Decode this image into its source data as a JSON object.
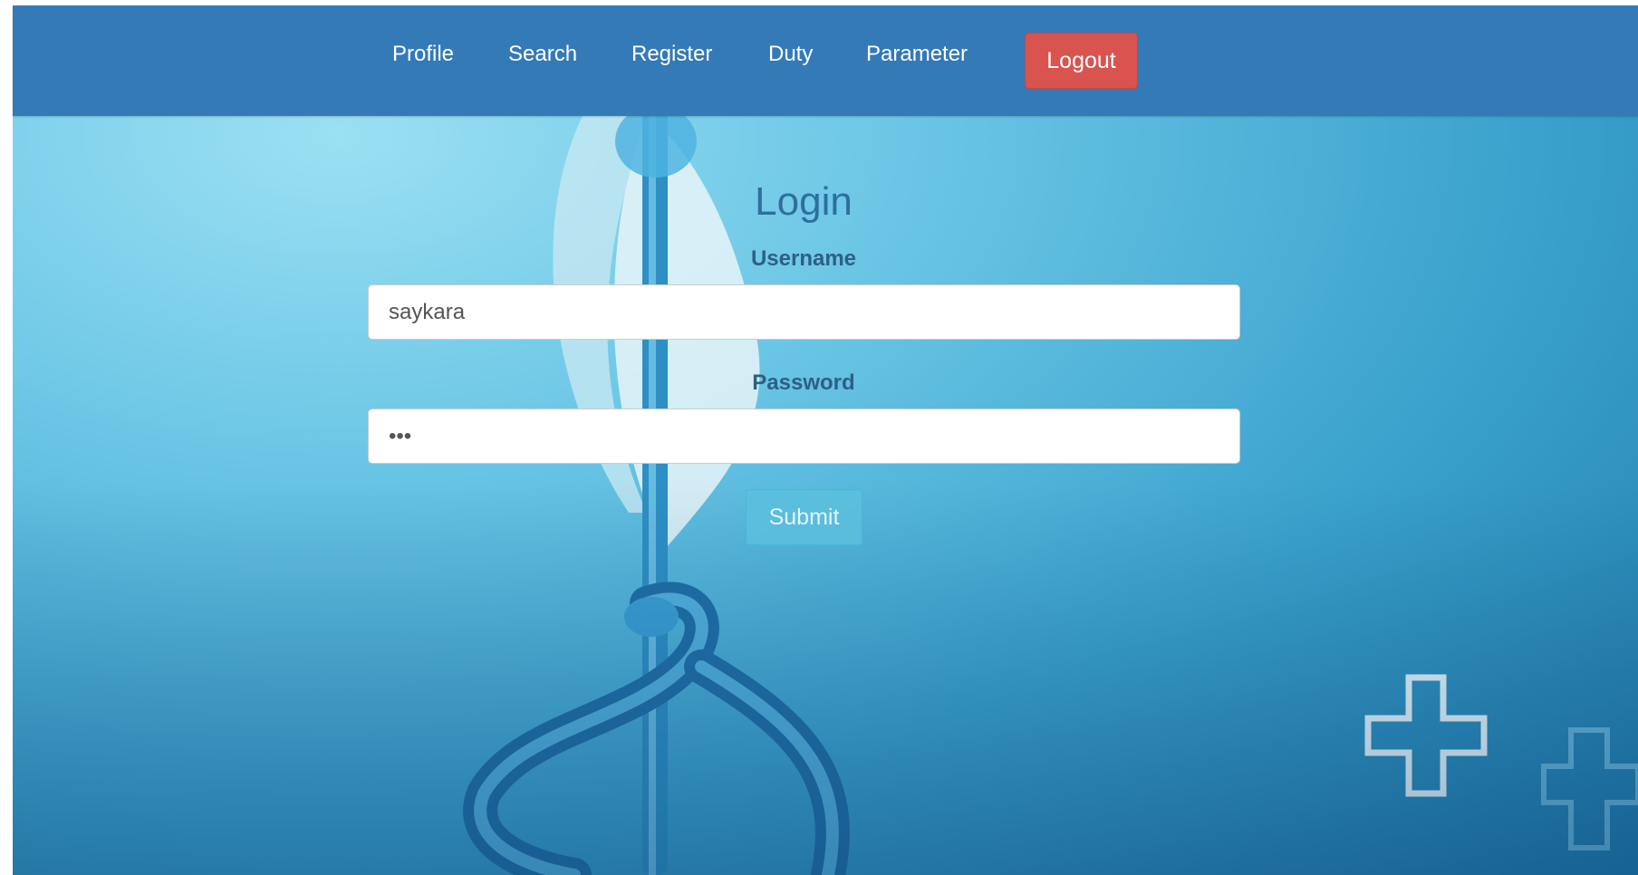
{
  "nav": {
    "items": [
      {
        "id": "profile",
        "label": "Profile"
      },
      {
        "id": "search",
        "label": "Search"
      },
      {
        "id": "register",
        "label": "Register"
      },
      {
        "id": "duty",
        "label": "Duty"
      },
      {
        "id": "parameter",
        "label": "Parameter"
      }
    ],
    "logout_label": "Logout"
  },
  "login": {
    "title": "Login",
    "username_label": "Username",
    "username_value": "saykara",
    "password_label": "Password",
    "password_value": "123",
    "submit_label": "Submit"
  },
  "background": {
    "icons": [
      "caduceus-icon",
      "medical-cross-icon"
    ]
  },
  "colors": {
    "navbar": "#337ab7",
    "logout": "#d9534f",
    "submit": "#5bc0de",
    "heading": "#2e6f9e"
  }
}
